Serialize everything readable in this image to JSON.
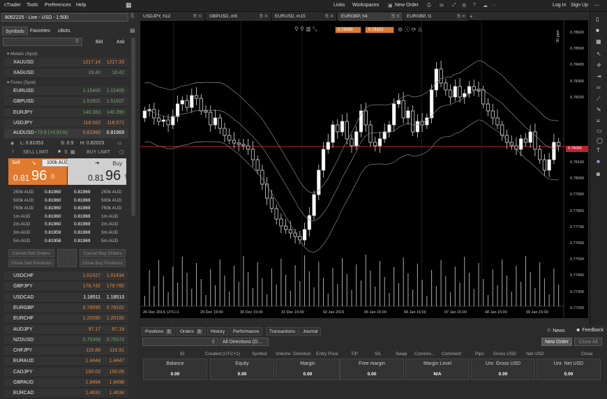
{
  "menu": {
    "app": "cTrader",
    "tools": "Tools",
    "prefs": "Preferences",
    "help": "Help",
    "links": "Links",
    "workspaces": "Workspaces",
    "new_order": "New Order",
    "login": "Log In",
    "signup": "Sign Up"
  },
  "account": "8062225 - Live - USD - 1:500",
  "chart_tabs": [
    "USDJPY, h12",
    "GBPUSD, m5",
    "EURUSD, m15",
    "EURGBP, h4",
    "EURGBP, t1"
  ],
  "left_tabs": [
    "Symbols",
    "Favorites",
    "cBots"
  ],
  "bid_label": "Bid",
  "ask_label": "Ask",
  "group_metals": "Metals (Spot)",
  "group_forex": "Forex (Spot)",
  "metals": [
    {
      "sym": "XAUUSD",
      "bid": "1217.14",
      "ask": "1217.33",
      "c": ""
    },
    {
      "sym": "XAGUSD",
      "bid": "16.40",
      "ask": "16.42",
      "c": "g"
    }
  ],
  "forex_top": [
    {
      "sym": "EURUSD",
      "bid": "1.15400",
      "ask": "1.15405",
      "c": "g"
    },
    {
      "sym": "GBPUSD",
      "bid": "1.51601",
      "ask": "1.51607",
      "c": "g"
    },
    {
      "sym": "EURJPY",
      "bid": "140.383",
      "ask": "140.390",
      "c": "g"
    },
    {
      "sym": "USDJPY",
      "bid": "118.563",
      "ask": "118.571",
      "c": ""
    }
  ],
  "selected": {
    "sym": "AUDUSD",
    "change": "+73.9 (+0.91%)",
    "bid": "0.81960",
    "ask": "0.81969",
    "low": "L: 0.81053",
    "spread": "S: 0.9",
    "high": "H: 0.82023",
    "sell_limit": "SELL LIMIT",
    "buy_limit": "BUY LIMIT",
    "sell": "Sell",
    "buy": "Buy",
    "volume": "100k AUD",
    "sell_big": "0.81",
    "sell_pips": "96",
    "sell_frac": "0",
    "buy_big": "0.81",
    "buy_pips": "96",
    "buy_frac": "9"
  },
  "depth": [
    {
      "v": "250k AUD",
      "b": "0.81960",
      "a": "0.81969",
      "av": "250k AUD"
    },
    {
      "v": "500k AUD",
      "b": "0.81960",
      "a": "0.81969",
      "av": "500k AUD"
    },
    {
      "v": "750k AUD",
      "b": "0.81960",
      "a": "0.81969",
      "av": "750k AUD"
    },
    {
      "v": "1m AUD",
      "b": "0.81960",
      "a": "0.81969",
      "av": "1m AUD"
    },
    {
      "v": "2m AUD",
      "b": "0.81960",
      "a": "0.81969",
      "av": "2m AUD"
    },
    {
      "v": "3m AUD",
      "b": "0.81959",
      "a": "0.81969",
      "av": "3m AUD"
    },
    {
      "v": "5m AUD",
      "b": "0.81958",
      "a": "0.81969",
      "av": "5m AUD"
    }
  ],
  "cancel_sell": "Cancel Sell Orders",
  "close_sell": "Close Sell Positions",
  "cancel_buy": "Cancel Buy Orders",
  "close_buy": "Close Buy Positions",
  "forex_bottom": [
    {
      "sym": "USDCHF",
      "bid": "1.01427",
      "ask": "1.01434",
      "c": ""
    },
    {
      "sym": "GBPJPY",
      "bid": "179.742",
      "ask": "179.765",
      "c": ""
    },
    {
      "sym": "USDCAD",
      "bid": "1.18511",
      "ask": "1.18513",
      "c": "w"
    },
    {
      "sym": "EURGBP",
      "bid": "0.78095",
      "ask": "0.78102",
      "c": ""
    },
    {
      "sym": "EURCHF",
      "bid": "1.20090",
      "ask": "1.20100",
      "c": ""
    },
    {
      "sym": "AUDJPY",
      "bid": "97.17",
      "ask": "97.19",
      "c": ""
    },
    {
      "sym": "NZDUSD",
      "bid": "0.75359",
      "ask": "0.75373",
      "c": "g"
    },
    {
      "sym": "CHFJPY",
      "bid": "116.88",
      "ask": "116.91",
      "c": ""
    },
    {
      "sym": "EURAUD",
      "bid": "1.4444",
      "ask": "1.4447",
      "c": ""
    },
    {
      "sym": "CADJPY",
      "bid": "100.03",
      "ask": "100.05",
      "c": ""
    },
    {
      "sym": "GBPAUD",
      "bid": "1.8494",
      "ask": "1.8498",
      "c": ""
    },
    {
      "sym": "EURCAD",
      "bid": "1.4631",
      "ask": "1.4634",
      "c": ""
    }
  ],
  "chart_data": {
    "type": "candlestick",
    "quote_bid": "0.78095",
    "quote_ask": "0.78102",
    "price_line": "0.78095",
    "y_ticks": [
      "0.78100",
      "0.78000",
      "0.77900",
      "0.77800",
      "0.77700",
      "0.77600",
      "0.77500",
      "0.77400",
      "0.77300",
      "0.77200"
    ],
    "y_ticks_top": [
      "0.78600",
      "0.78500",
      "0.78400",
      "0.78300",
      "0.78200"
    ],
    "x_ticks": [
      "26 Dec 2014, UTC+1",
      "29 Dec 19:00",
      "30 Dec 19:00",
      "31 Dec 19:00",
      "02 Jan 2015",
      "05 Jan 15:00",
      "06 Jan 15:00",
      "07 Jan 15:00",
      "08 Jan 15:00",
      "09 Jan 15:00"
    ],
    "pips_label": "30 pips",
    "ylim": [
      0.7715,
      0.788
    ]
  },
  "bottom_tabs": [
    {
      "l": "Positions",
      "n": "0"
    },
    {
      "l": "Orders",
      "n": "0"
    },
    {
      "l": "History"
    },
    {
      "l": "Performance"
    },
    {
      "l": "Transactions"
    },
    {
      "l": "Journal"
    }
  ],
  "news": "News",
  "feedback": "Feedback",
  "directions": "All Directions (D...",
  "new_order_btn": "New Order",
  "close_all": "Close All",
  "cols": [
    "ID",
    "Created (UTC+1)",
    "Symbol",
    "Volume",
    "Direction",
    "Entry Price",
    "T/P",
    "S/L",
    "Swap",
    "Commis...",
    "Comment",
    "Pips",
    "Gross USD",
    "Net USD",
    "Close"
  ],
  "summary": [
    {
      "l": "Balance",
      "v": "0.00"
    },
    {
      "l": "Equity",
      "v": "0.00"
    },
    {
      "l": "Margin",
      "v": "0.00"
    },
    {
      "l": "Free margin",
      "v": "0.00"
    },
    {
      "l": "Margin Level",
      "v": "N/A"
    },
    {
      "l": "Unr. Gross USD",
      "v": "0.00"
    },
    {
      "l": "Unr. Net USD",
      "v": "0.00"
    }
  ]
}
